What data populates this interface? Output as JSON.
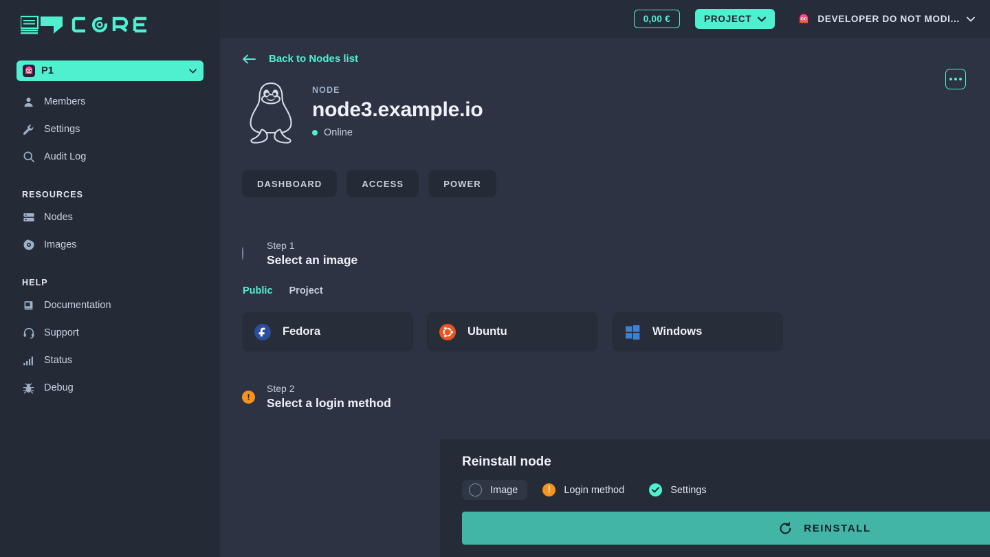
{
  "brand": {
    "logo_text": "CORE",
    "accent": "#4ff0d0"
  },
  "sidebar": {
    "project_selector": {
      "label": "P1",
      "avatar": "ghost-avatar",
      "chevron": "chevron-down-icon"
    },
    "items": [
      {
        "label": "Members",
        "icon": "user-icon"
      },
      {
        "label": "Settings",
        "icon": "wrench-icon"
      },
      {
        "label": "Audit Log",
        "icon": "search-icon"
      }
    ],
    "groups": [
      {
        "title": "RESOURCES",
        "items": [
          {
            "label": "Nodes",
            "icon": "server-icon"
          },
          {
            "label": "Images",
            "icon": "disc-icon"
          }
        ]
      },
      {
        "title": "HELP",
        "items": [
          {
            "label": "Documentation",
            "icon": "book-icon"
          },
          {
            "label": "Support",
            "icon": "headset-icon"
          },
          {
            "label": "Status",
            "icon": "bar-chart-icon"
          },
          {
            "label": "Debug",
            "icon": "bug-icon"
          }
        ]
      }
    ]
  },
  "topbar": {
    "credit": "0,00 €",
    "project_button": "PROJECT",
    "user_name": "DEVELOPER DO NOT MODI...",
    "user_avatar": "ghost-avatar"
  },
  "content": {
    "back_link": "Back to Nodes list",
    "node_kind": "NODE",
    "node_title": "node3.example.io",
    "node_status": "Online",
    "status_color": "#4ff0d0",
    "kebab": "more-options",
    "tabs": [
      {
        "label": "DASHBOARD"
      },
      {
        "label": "ACCESS"
      },
      {
        "label": "POWER"
      }
    ],
    "step1": {
      "step": "Step 1",
      "title": "Select an image",
      "state": "pending"
    },
    "image_source_tabs": [
      {
        "label": "Public",
        "active": true
      },
      {
        "label": "Project",
        "active": false
      }
    ],
    "os_cards": [
      {
        "label": "Fedora",
        "icon": "fedora-icon"
      },
      {
        "label": "Ubuntu",
        "icon": "ubuntu-icon"
      },
      {
        "label": "Windows",
        "icon": "windows-icon"
      }
    ],
    "step2": {
      "step": "Step 2",
      "title": "Select a login method",
      "state": "warning"
    }
  },
  "bottom_panel": {
    "title": "Reinstall node",
    "steps": [
      {
        "label": "Image",
        "state": "pending",
        "selected": true
      },
      {
        "label": "Login method",
        "state": "warning",
        "selected": false
      },
      {
        "label": "Settings",
        "state": "done",
        "selected": false
      }
    ],
    "action_button": {
      "label": "REINSTALL",
      "icon": "restore-icon",
      "color": "#43b5a6"
    }
  }
}
